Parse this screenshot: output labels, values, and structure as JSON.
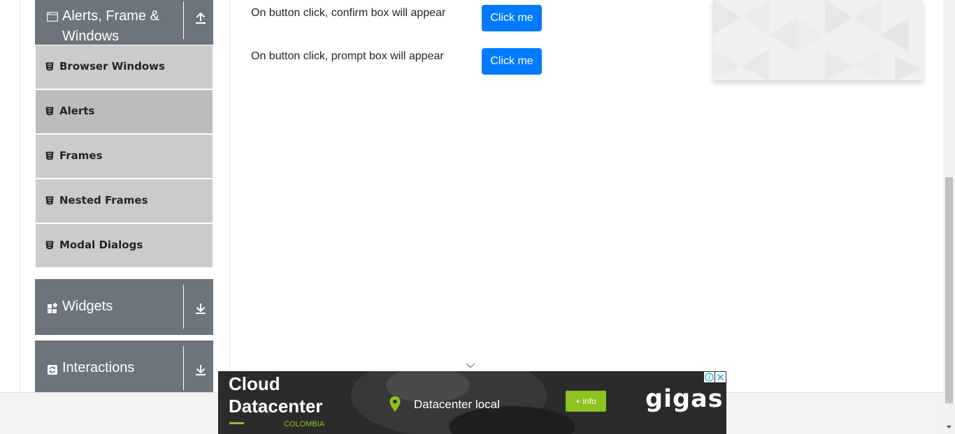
{
  "sidebar": {
    "alerts_group": {
      "title_line1": "Alerts, Frame &",
      "title_line2": "Windows",
      "icon": "window-icon",
      "toggle_icon": "arrow-up-icon"
    },
    "items": [
      {
        "label": "Browser Windows",
        "icon": "html5-icon",
        "active": false
      },
      {
        "label": "Alerts",
        "icon": "html5-icon",
        "active": true
      },
      {
        "label": "Frames",
        "icon": "html5-icon",
        "active": false
      },
      {
        "label": "Nested Frames",
        "icon": "html5-icon",
        "active": false
      },
      {
        "label": "Modal Dialogs",
        "icon": "html5-icon",
        "active": false
      }
    ],
    "widgets_group": {
      "title": "Widgets",
      "icon": "widgets-icon",
      "toggle_icon": "arrow-down-icon"
    },
    "interactions_group": {
      "title": "Interactions",
      "icon": "interactions-icon",
      "toggle_icon": "arrow-down-icon"
    }
  },
  "main": {
    "rows": [
      {
        "text": "On button click, confirm box will appear",
        "button_label": "Click me"
      },
      {
        "text": "On button click, prompt box will appear",
        "button_label": "Click me"
      }
    ]
  },
  "ad": {
    "headline_line1": "Cloud",
    "headline_line2": "Datacenter",
    "country": "COLOMBIA",
    "location_text": "Datacenter local",
    "info_button": "+ info",
    "brand": "gigas"
  },
  "colors": {
    "primary": "#007bff",
    "sidebar_header": "#6c757d",
    "menu_item": "#cbcbcb",
    "menu_item_active": "#bcbcbc",
    "ad_accent": "#8dc31f"
  }
}
